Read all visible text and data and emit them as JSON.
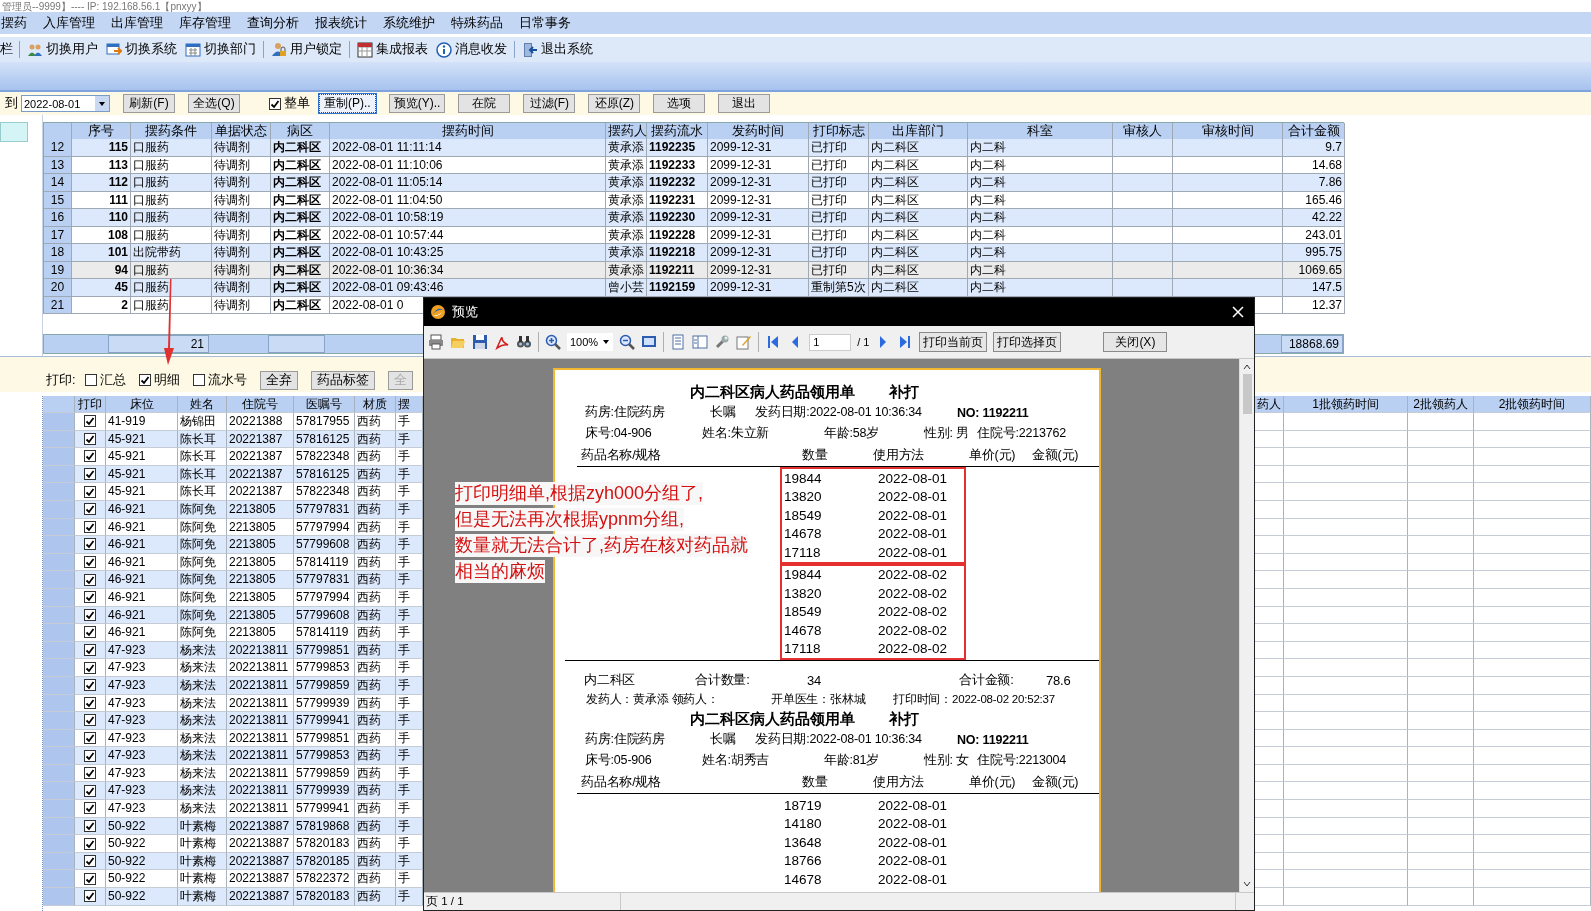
{
  "window": {
    "title": "管理员--9999】---- IP: 192.168.56.1【pnxyy】"
  },
  "menu": [
    "摆药",
    "入库管理",
    "出库管理",
    "库存管理",
    "查询分析",
    "报表统计",
    "系统维护",
    "特殊药品",
    "日常事务"
  ],
  "toolbar": [
    {
      "kind": "fragment",
      "label": "栏",
      "separator_before": false
    },
    {
      "kind": "button",
      "label": "切换用户",
      "separator_before": true
    },
    {
      "kind": "button",
      "label": "切换系统",
      "separator_before": false
    },
    {
      "kind": "button",
      "label": "切换部门",
      "separator_before": false
    },
    {
      "kind": "button",
      "label": "用户锁定",
      "separator_before": true
    },
    {
      "kind": "button",
      "label": "集成报表",
      "separator_before": true
    },
    {
      "kind": "button",
      "label": "消息收发",
      "separator_before": false
    },
    {
      "kind": "button",
      "label": "退出系统",
      "separator_before": true
    }
  ],
  "filter_bar": [
    {
      "kind": "label",
      "text": "到"
    },
    {
      "kind": "date",
      "value": "2022-08-01"
    },
    {
      "kind": "button",
      "label": "刷新(F)",
      "focused": false
    },
    {
      "kind": "button",
      "label": "全选(Q)",
      "focused": false
    },
    {
      "kind": "checkbox",
      "label": "整单",
      "checked": true
    },
    {
      "kind": "button",
      "label": "重制(P)..",
      "focused": true
    },
    {
      "kind": "button",
      "label": "预览(Y)..",
      "focused": false
    },
    {
      "kind": "button",
      "label": "在院",
      "focused": false
    },
    {
      "kind": "button",
      "label": "过滤(F)",
      "focused": false
    },
    {
      "kind": "button",
      "label": "还原(Z)",
      "focused": false
    },
    {
      "kind": "button",
      "label": "选项",
      "focused": false
    },
    {
      "kind": "button",
      "label": "退出",
      "focused": false
    }
  ],
  "top_table": {
    "columns": [
      {
        "title": "序号"
      },
      {
        "title": "摆药条件"
      },
      {
        "title": "单据状态"
      },
      {
        "title": "病区"
      },
      {
        "title": "摆药时间"
      },
      {
        "title": "摆药人"
      },
      {
        "title": "摆药流水"
      },
      {
        "title": "发药时间"
      },
      {
        "title": "打印标志"
      },
      {
        "title": "出库部门"
      },
      {
        "title": "科室"
      },
      {
        "title": "审核人"
      },
      {
        "title": "审核时间"
      },
      {
        "title": "合计金额"
      }
    ],
    "rows": [
      {
        "index": "12",
        "selected": false,
        "cells": [
          "115",
          "口服药",
          "待调剂",
          "内二科区",
          "2022-08-01 11:11:14",
          "黄承添",
          "1192235",
          "2099-12-31",
          "已打印",
          "内二科区",
          "内二科",
          null,
          null,
          "9.7"
        ]
      },
      {
        "index": "13",
        "selected": false,
        "cells": [
          "113",
          "口服药",
          "待调剂",
          "内二科区",
          "2022-08-01 11:10:06",
          "黄承添",
          "1192233",
          "2099-12-31",
          "已打印",
          "内二科区",
          "内二科",
          null,
          null,
          "14.68"
        ]
      },
      {
        "index": "14",
        "selected": false,
        "cells": [
          "112",
          "口服药",
          "待调剂",
          "内二科区",
          "2022-08-01 11:05:14",
          "黄承添",
          "1192232",
          "2099-12-31",
          "已打印",
          "内二科区",
          "内二科",
          null,
          null,
          "7.86"
        ]
      },
      {
        "index": "15",
        "selected": false,
        "cells": [
          "111",
          "口服药",
          "待调剂",
          "内二科区",
          "2022-08-01 11:04:50",
          "黄承添",
          "1192231",
          "2099-12-31",
          "已打印",
          "内二科区",
          "内二科",
          null,
          null,
          "165.46"
        ]
      },
      {
        "index": "16",
        "selected": false,
        "cells": [
          "110",
          "口服药",
          "待调剂",
          "内二科区",
          "2022-08-01 10:58:19",
          "黄承添",
          "1192230",
          "2099-12-31",
          "已打印",
          "内二科区",
          "内二科",
          null,
          null,
          "42.22"
        ]
      },
      {
        "index": "17",
        "selected": false,
        "cells": [
          "108",
          "口服药",
          "待调剂",
          "内二科区",
          "2022-08-01 10:57:44",
          "黄承添",
          "1192228",
          "2099-12-31",
          "已打印",
          "内二科区",
          "内二科",
          null,
          null,
          "243.01"
        ]
      },
      {
        "index": "18",
        "selected": false,
        "cells": [
          "101",
          "出院带药",
          "待调剂",
          "内二科区",
          "2022-08-01 10:43:25",
          "黄承添",
          "1192218",
          "2099-12-31",
          "已打印",
          "内二科区",
          "内二科",
          null,
          null,
          "995.75"
        ]
      },
      {
        "index": "19",
        "selected": true,
        "cells": [
          "94",
          "口服药",
          "待调剂",
          "内二科区",
          "2022-08-01 10:36:34",
          "黄承添",
          "1192211",
          "2099-12-31",
          "已打印",
          "内二科区",
          "内二科",
          null,
          null,
          "1069.65"
        ]
      },
      {
        "index": "20",
        "selected": false,
        "cells": [
          "45",
          "口服药",
          "待调剂",
          "内二科区",
          "2022-08-01 09:43:46",
          "曾小芸",
          "1192159",
          "2099-12-31",
          "重制第5次",
          "内二科区",
          "内二科",
          null,
          null,
          "147.5"
        ]
      },
      {
        "index": "21",
        "selected": false,
        "cells": [
          "2",
          "口服药",
          "待调剂",
          "内二科区",
          "2022-08-01 0",
          null,
          null,
          null,
          null,
          null,
          null,
          null,
          null,
          "12.37"
        ]
      }
    ],
    "footer": {
      "count": "21",
      "total": "18868.69"
    }
  },
  "print_bar": {
    "label": "打印:",
    "options": [
      {
        "label": "汇总",
        "checked": false
      },
      {
        "label": "明细",
        "checked": true
      },
      {
        "label": "流水号",
        "checked": false
      }
    ],
    "buttons": [
      {
        "label": "全弃",
        "disabled": false
      },
      {
        "label": "药品标签",
        "disabled": false
      },
      {
        "label": "全",
        "disabled": true
      }
    ]
  },
  "bottom_table": {
    "columns_left": [
      "打印",
      "床位",
      "姓名",
      "住院号",
      "医嘱号",
      "材质",
      "摆"
    ],
    "columns_right": [
      "药人",
      "1批领药时间",
      "2批领药人",
      "2批领药时间"
    ],
    "rows": [
      {
        "checked": true,
        "cells": [
          "41-919",
          "杨锦田",
          "20221388",
          "57817955",
          "西药",
          "手"
        ]
      },
      {
        "checked": true,
        "cells": [
          "45-921",
          "陈长耳",
          "20221387",
          "57816125",
          "西药",
          "手"
        ]
      },
      {
        "checked": true,
        "cells": [
          "45-921",
          "陈长耳",
          "20221387",
          "57822348",
          "西药",
          "手"
        ]
      },
      {
        "checked": true,
        "cells": [
          "45-921",
          "陈长耳",
          "20221387",
          "57816125",
          "西药",
          "手"
        ]
      },
      {
        "checked": true,
        "cells": [
          "45-921",
          "陈长耳",
          "20221387",
          "57822348",
          "西药",
          "手"
        ]
      },
      {
        "checked": true,
        "cells": [
          "46-921",
          "陈阿免",
          "2213805",
          "57797831",
          "西药",
          "手"
        ]
      },
      {
        "checked": true,
        "cells": [
          "46-921",
          "陈阿免",
          "2213805",
          "57797994",
          "西药",
          "手"
        ]
      },
      {
        "checked": true,
        "cells": [
          "46-921",
          "陈阿免",
          "2213805",
          "57799608",
          "西药",
          "手"
        ]
      },
      {
        "checked": true,
        "cells": [
          "46-921",
          "陈阿免",
          "2213805",
          "57814119",
          "西药",
          "手"
        ]
      },
      {
        "checked": true,
        "cells": [
          "46-921",
          "陈阿免",
          "2213805",
          "57797831",
          "西药",
          "手"
        ]
      },
      {
        "checked": true,
        "cells": [
          "46-921",
          "陈阿免",
          "2213805",
          "57797994",
          "西药",
          "手"
        ]
      },
      {
        "checked": true,
        "cells": [
          "46-921",
          "陈阿免",
          "2213805",
          "57799608",
          "西药",
          "手"
        ]
      },
      {
        "checked": true,
        "cells": [
          "46-921",
          "陈阿免",
          "2213805",
          "57814119",
          "西药",
          "手"
        ]
      },
      {
        "checked": true,
        "cells": [
          "47-923",
          "杨来法",
          "202213811",
          "57799851",
          "西药",
          "手"
        ]
      },
      {
        "checked": true,
        "cells": [
          "47-923",
          "杨来法",
          "202213811",
          "57799853",
          "西药",
          "手"
        ]
      },
      {
        "checked": true,
        "cells": [
          "47-923",
          "杨来法",
          "202213811",
          "57799859",
          "西药",
          "手"
        ]
      },
      {
        "checked": true,
        "cells": [
          "47-923",
          "杨来法",
          "202213811",
          "57799939",
          "西药",
          "手"
        ]
      },
      {
        "checked": true,
        "cells": [
          "47-923",
          "杨来法",
          "202213811",
          "57799941",
          "西药",
          "手"
        ]
      },
      {
        "checked": true,
        "cells": [
          "47-923",
          "杨来法",
          "202213811",
          "57799851",
          "西药",
          "手"
        ]
      },
      {
        "checked": true,
        "cells": [
          "47-923",
          "杨来法",
          "202213811",
          "57799853",
          "西药",
          "手"
        ]
      },
      {
        "checked": true,
        "cells": [
          "47-923",
          "杨来法",
          "202213811",
          "57799859",
          "西药",
          "手"
        ]
      },
      {
        "checked": true,
        "cells": [
          "47-923",
          "杨来法",
          "202213811",
          "57799939",
          "西药",
          "手"
        ]
      },
      {
        "checked": true,
        "cells": [
          "47-923",
          "杨来法",
          "202213811",
          "57799941",
          "西药",
          "手"
        ]
      },
      {
        "checked": true,
        "cells": [
          "50-922",
          "叶素梅",
          "202213887",
          "57819868",
          "西药",
          "手"
        ]
      },
      {
        "checked": true,
        "cells": [
          "50-922",
          "叶素梅",
          "202213887",
          "57820183",
          "西药",
          "手"
        ]
      },
      {
        "checked": true,
        "cells": [
          "50-922",
          "叶素梅",
          "202213887",
          "57820185",
          "西药",
          "手"
        ]
      },
      {
        "checked": true,
        "cells": [
          "50-922",
          "叶素梅",
          "202213887",
          "57822372",
          "西药",
          "手"
        ]
      },
      {
        "checked": true,
        "cells": [
          "50-922",
          "叶素梅",
          "202213887",
          "57820183",
          "西药",
          "手"
        ]
      }
    ]
  },
  "preview_dialog": {
    "title": "预览",
    "zoom": "100%",
    "page_field": "1",
    "page_total": "/ 1",
    "buttons": [
      "打印当前页",
      "打印选择页"
    ],
    "close_button": "关闭(X)",
    "status": "页 1 / 1",
    "documents": [
      {
        "title": "内二科区病人药品领用单",
        "reprint": "补打",
        "line1": [
          "药房:住院药房",
          "长嘱",
          "发药日期:2022-08-01 10:36:34",
          "NO: 1192211"
        ],
        "line2": [
          "床号:04-906",
          "姓名:朱立新",
          "年龄:58岁",
          "性别: 男",
          "住院号:2213762"
        ],
        "header": [
          "药品名称/规格",
          "数量",
          "使用方法",
          "单价(元)",
          "金额(元)"
        ],
        "groups": [
          {
            "highlighted": true,
            "items": [
              {
                "qty": "19844",
                "usage": "2022-08-01"
              },
              {
                "qty": "13820",
                "usage": "2022-08-01"
              },
              {
                "qty": "18549",
                "usage": "2022-08-01"
              },
              {
                "qty": "14678",
                "usage": "2022-08-01"
              },
              {
                "qty": "17118",
                "usage": "2022-08-01"
              }
            ]
          },
          {
            "highlighted": true,
            "items": [
              {
                "qty": "19844",
                "usage": "2022-08-02"
              },
              {
                "qty": "13820",
                "usage": "2022-08-02"
              },
              {
                "qty": "18549",
                "usage": "2022-08-02"
              },
              {
                "qty": "14678",
                "usage": "2022-08-02"
              },
              {
                "qty": "17118",
                "usage": "2022-08-02"
              }
            ]
          }
        ],
        "summary": {
          "dept": "内二科区",
          "qty_label": "合计数量:",
          "qty": "34",
          "amount_label": "合计金额:",
          "amount": "78.6"
        },
        "signatures": [
          "发药人：黄承添  领药人：",
          "开单医生：张林城",
          "打印时间：2022-08-02 20:52:37"
        ]
      },
      {
        "title": "内二科区病人药品领用单",
        "reprint": "补打",
        "line1": [
          "药房:住院药房",
          "长嘱",
          "发药日期:2022-08-01 10:36:34",
          "NO: 1192211"
        ],
        "line2": [
          "床号:05-906",
          "姓名:胡秀吉",
          "年龄:81岁",
          "性别: 女",
          "住院号:2213004"
        ],
        "header": [
          "药品名称/规格",
          "数量",
          "使用方法",
          "单价(元)",
          "金额(元)"
        ],
        "groups": [
          {
            "highlighted": false,
            "items": [
              {
                "qty": "18719",
                "usage": "2022-08-01"
              },
              {
                "qty": "14180",
                "usage": "2022-08-01"
              },
              {
                "qty": "13648",
                "usage": "2022-08-01"
              },
              {
                "qty": "18766",
                "usage": "2022-08-01"
              },
              {
                "qty": "14678",
                "usage": "2022-08-01"
              }
            ]
          }
        ]
      }
    ]
  },
  "annotation": {
    "lines": [
      "打印明细单,根据zyh000分组了,",
      "但是无法再次根据ypnm分组,",
      "数量就无法合计了,药房在核对药品就",
      "相当的麻烦"
    ]
  }
}
